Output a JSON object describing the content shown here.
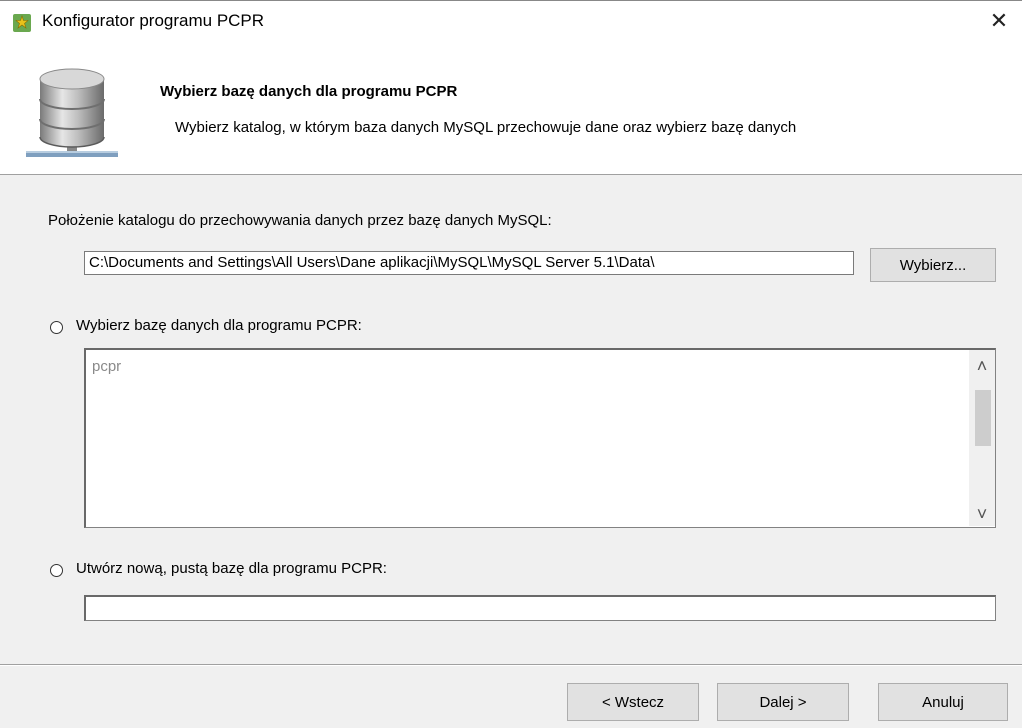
{
  "window": {
    "title": "Konfigurator programu PCPR",
    "close_glyph": "✕"
  },
  "header": {
    "title": "Wybierz bazę danych dla programu PCPR",
    "subtitle": "Wybierz katalog, w którym baza danych MySQL przechowuje dane oraz wybierz bazę danych",
    "icon": "database-icon"
  },
  "location": {
    "label": "Położenie katalogu do przechowywania danych przez bazę danych MySQL:",
    "path_value": "C:\\Documents and Settings\\All Users\\Dane aplikacji\\MySQL\\MySQL Server 5.1\\Data\\",
    "browse_label": "Wybierz..."
  },
  "select_db": {
    "radio_label": "Wybierz bazę danych dla programu PCPR:",
    "selected": false,
    "items": [
      "pcpr"
    ],
    "scroll_up_glyph": "˄",
    "scroll_down_glyph": "˅"
  },
  "new_db": {
    "radio_label": "Utwórz nową, pustą bazę dla programu PCPR:",
    "selected": false,
    "value": ""
  },
  "footer": {
    "back_label": "< Wstecz",
    "next_label": "Dalej >",
    "cancel_label": "Anuluj"
  }
}
